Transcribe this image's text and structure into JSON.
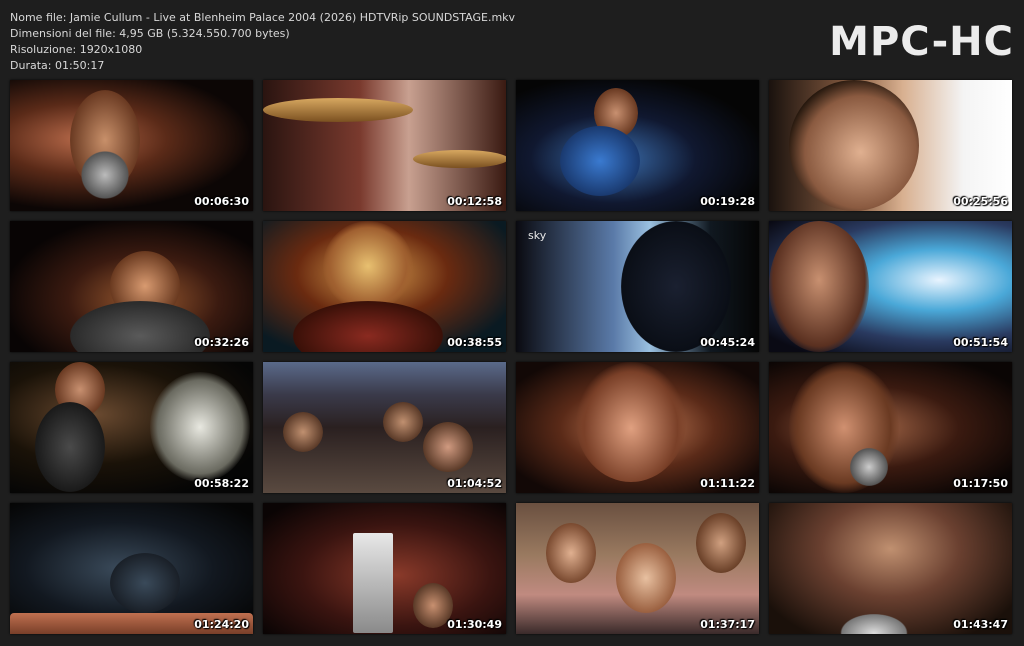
{
  "header": {
    "file_name": "Nome file: Jamie Cullum - Live at Blenheim Palace 2004 (2026) HDTVRip SOUNDSTAGE.mkv",
    "file_size": "Dimensioni del file: 4,95 GB (5.324.550.700 bytes)",
    "resolution": "Risoluzione: 1920x1080",
    "duration": "Durata: 01:50:17"
  },
  "brand": "MPC-HC",
  "thumbnails": [
    {
      "time": "00:06:30"
    },
    {
      "time": "00:12:58"
    },
    {
      "time": "00:19:28"
    },
    {
      "time": "00:25:56"
    },
    {
      "time": "00:32:26"
    },
    {
      "time": "00:38:55"
    },
    {
      "time": "00:45:24",
      "logo": "sky"
    },
    {
      "time": "00:51:54"
    },
    {
      "time": "00:58:22"
    },
    {
      "time": "01:04:52"
    },
    {
      "time": "01:11:22"
    },
    {
      "time": "01:17:50"
    },
    {
      "time": "01:24:20"
    },
    {
      "time": "01:30:49"
    },
    {
      "time": "01:37:17"
    },
    {
      "time": "01:43:47"
    }
  ]
}
